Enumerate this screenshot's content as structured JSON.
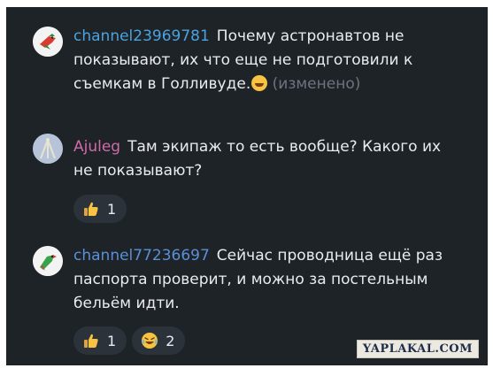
{
  "messages": [
    {
      "author": "channel23969781",
      "author_color": "#4aa3df",
      "text": "Почему астронавтов не показывают, их что еще не подготовили к съемкам в Голливуде.",
      "edited": "(изменено)",
      "avatar_icon": "parrot-avatar-icon"
    },
    {
      "author": "Ajuleg",
      "author_color": "#d16aa8",
      "text": "Там экипаж то есть вообще? Какого их не показывают?",
      "avatar_icon": "tripod-avatar-icon",
      "reactions": [
        {
          "icon": "thumbs-up-icon",
          "count": "1"
        }
      ]
    },
    {
      "author": "channel77236697",
      "author_color": "#5b8fd6",
      "text": "Сейчас проводница ещё раз паспорта проверит, и можно за постельным бельём идти.",
      "avatar_icon": "parrot-avatar-icon",
      "reactions": [
        {
          "icon": "thumbs-up-icon",
          "count": "1"
        },
        {
          "icon": "laughing-face-icon",
          "count": "2"
        }
      ]
    }
  ],
  "watermark": "YAPLAKAL.COM"
}
